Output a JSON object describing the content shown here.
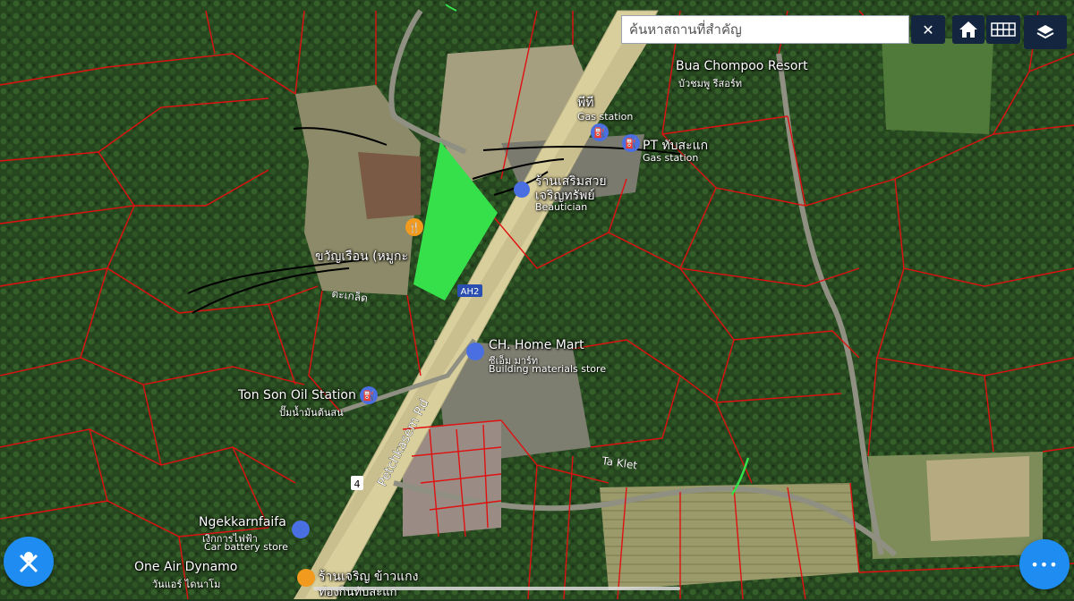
{
  "search": {
    "placeholder": "ค้นหาสถานที่สำคัญ",
    "clear_glyph": "✕"
  },
  "toolbar": {
    "home_icon": "home-icon",
    "grid_icon": "grid-icon",
    "layers_icon": "layers-icon"
  },
  "fab": {
    "more_glyph": "•••",
    "left_glyph": "✕"
  },
  "colors": {
    "parcel_line": "#e01010",
    "highlight": "#35e04a",
    "topbar": "#0e1e38",
    "fab": "#1e8cf0",
    "road": "#d9cf9c"
  },
  "places": {
    "resort": {
      "name": "Bua Chompoo Resort",
      "sub": "บัวชมพู รีสอร์ท"
    },
    "pt1": {
      "name": "พีที",
      "sub": "Gas station"
    },
    "pt2": {
      "name": "PT ทับสะแก",
      "sub": "Gas station"
    },
    "beauty": {
      "name": "ร้านเสริมสวย",
      "name2": "เจริญทรัพย์",
      "sub": "Beautician"
    },
    "khwan": {
      "name": "ขวัญเรือน (หมูกะ"
    },
    "taklet_th": {
      "name": "ตะเกล็ด"
    },
    "ah2": {
      "name": "AH2"
    },
    "chome": {
      "name": "CH. Home Mart",
      "sub": "ซีเอ็ม มาร์ท",
      "sub2": "Building materials store"
    },
    "tonson": {
      "name": "Ton Son Oil Station",
      "sub": "ปั๊มน้ำมันต้นสน"
    },
    "petch": {
      "name": "Petchkasem Rd"
    },
    "shield": {
      "name": "4"
    },
    "taklet": {
      "name": "Ta Klet"
    },
    "ngek": {
      "name": "Ngekkarnfaifa",
      "sub": "เงิกการไฟฟ้า",
      "sub2": "Car battery store"
    },
    "oneair": {
      "name": "One Air Dynamo",
      "sub": "วันแอร์ ไดนาโม"
    },
    "rice": {
      "name": "ร้านเจริญ ข้าวแกง",
      "name2": "ท่องกินทับสะแก"
    }
  }
}
